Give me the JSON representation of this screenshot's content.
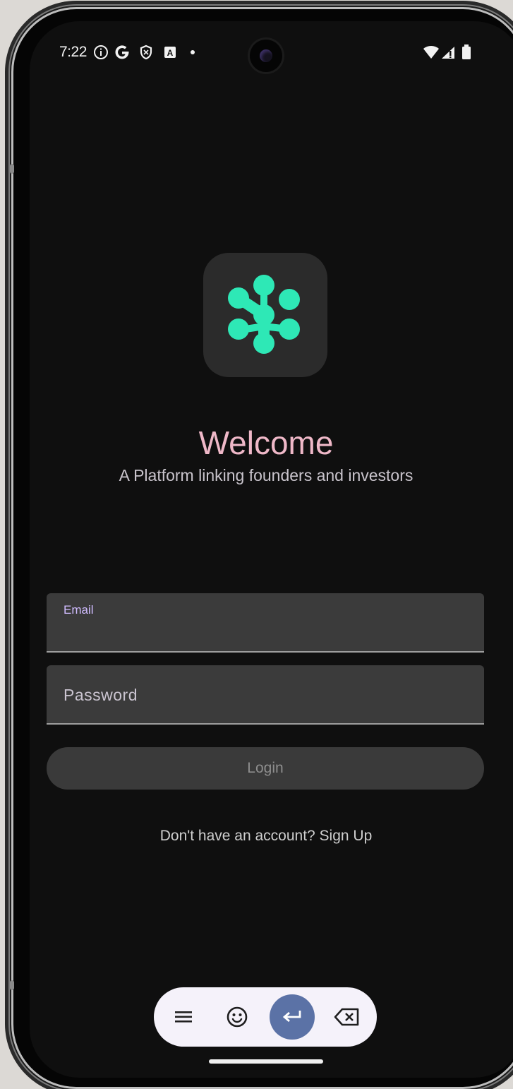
{
  "status_bar": {
    "time": "7:22",
    "icons": [
      "info-icon",
      "google-icon",
      "shield-icon",
      "translate-icon",
      "dot-icon",
      "wifi-icon",
      "signal-icon",
      "battery-icon"
    ]
  },
  "app": {
    "logo_icon": "molecule-logo-icon",
    "logo_color": "#2ee8b6",
    "title": "Welcome",
    "subtitle": "A Platform linking founders and investors",
    "email_label": "Email",
    "email_value": "",
    "password_label": "Password",
    "login_label": "Login",
    "signup_prompt": "Don't have an account? Sign Up",
    "title_color": "#efb8c8"
  },
  "keyboard_toolbar": {
    "buttons": [
      "menu-icon",
      "emoji-icon",
      "enter-icon",
      "backspace-icon"
    ]
  }
}
